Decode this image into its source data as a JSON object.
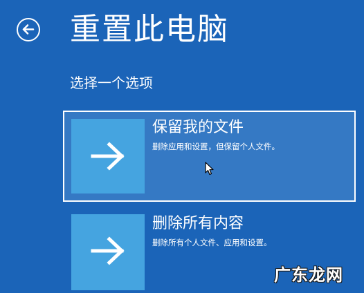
{
  "header": {
    "title": "重置此电脑",
    "subtitle": "选择一个选项"
  },
  "options": [
    {
      "title": "保留我的文件",
      "description": "删除应用和设置，但保留个人文件。",
      "icon": "arrow-right-icon",
      "selected": true
    },
    {
      "title": "删除所有内容",
      "description": "删除所有个人文件、应用和设置。",
      "icon": "arrow-right-icon",
      "selected": false
    }
  ],
  "watermark": "广东龙网",
  "colors": {
    "background": "#1b64b8",
    "tile": "#45a4e0",
    "selected_background": "#3579c4",
    "text": "#ffffff"
  }
}
